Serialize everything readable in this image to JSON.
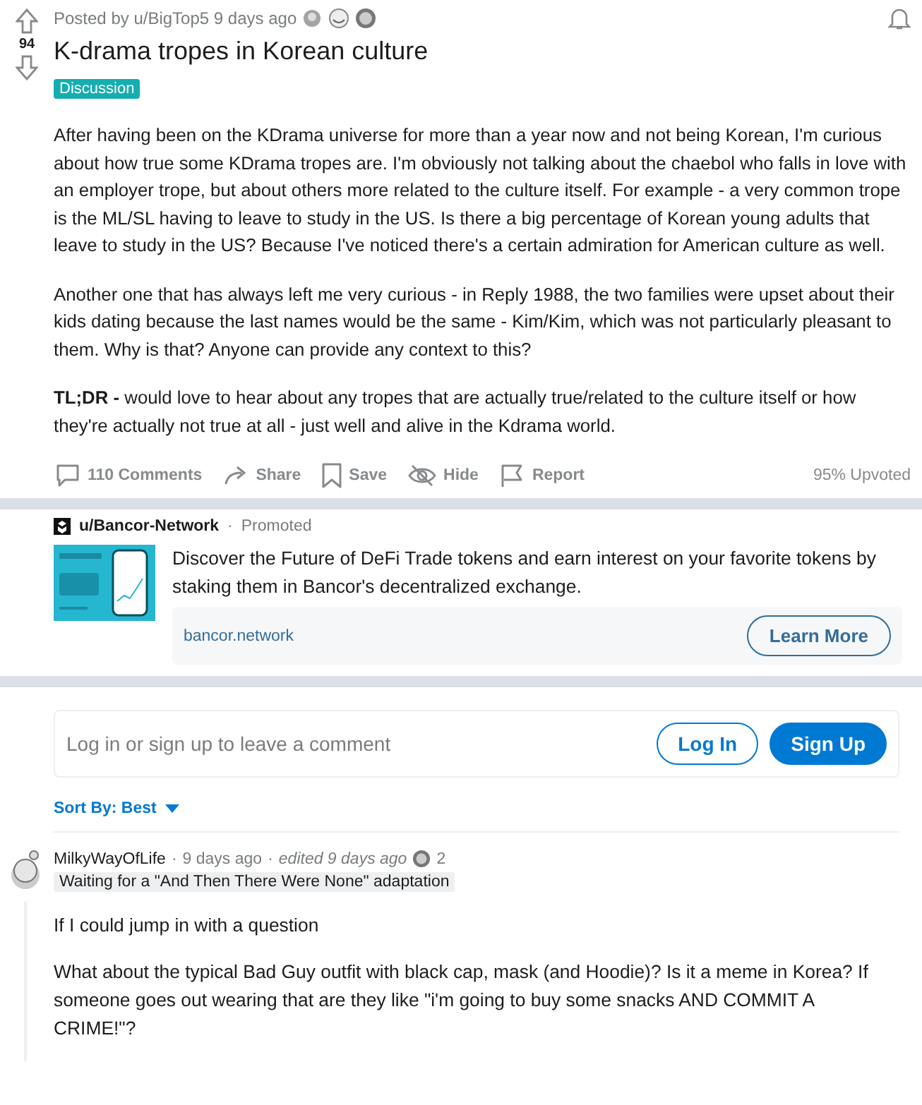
{
  "post": {
    "byline": "Posted by u/BigTop5 9 days ago",
    "votes": "94",
    "title": "K-drama tropes in Korean culture",
    "flair": "Discussion",
    "paragraphs": [
      "After having been on the KDrama universe for more than a year now and not being Korean, I'm curious about how true some KDrama tropes are. I'm obviously not talking about the chaebol who falls in love with an employer trope, but about others more related to the culture itself. For example - a very common trope is the ML/SL having to leave to study in the US. Is there a big percentage of Korean young adults that leave to study in the US? Because I've noticed there's a certain admiration for American culture as well.",
      "Another one that has always left me very curious - in Reply 1988, the two families were upset about their kids dating because the last names would be the same - Kim/Kim, which was not particularly pleasant to them. Why is that? Anyone can provide any context to this?",
      "**TL;DR -** would love to hear about any tropes that are actually true/related to the culture itself or how they're actually not true at all - just well and alive in the Kdrama world."
    ],
    "actions": [
      {
        "kind": "comments",
        "label": "110 Comments"
      },
      {
        "kind": "share",
        "label": "Share"
      },
      {
        "kind": "save",
        "label": "Save"
      },
      {
        "kind": "hide",
        "label": "Hide"
      },
      {
        "kind": "report",
        "label": "Report"
      }
    ],
    "upvoted": "95% Upvoted"
  },
  "ad": {
    "user": "u/Bancor-Network",
    "separator": "·",
    "promoted": "Promoted",
    "text": "Discover the Future of DeFi Trade tokens and earn interest on your favorite tokens by staking them in Bancor's decentralized exchange.",
    "domain": "bancor.network",
    "button": "Learn More"
  },
  "comment_box": {
    "placeholder": "Log in or sign up to leave a comment",
    "buttons": [
      {
        "kind": "outline",
        "label": "Log In"
      },
      {
        "kind": "filled",
        "label": "Sign Up"
      }
    ]
  },
  "sort": {
    "label": "Sort By: Best"
  },
  "comments": [
    {
      "author": "MilkyWayOfLife",
      "separator": "·",
      "time": "9 days ago",
      "edited": "edited 9 days ago",
      "award_count": "2",
      "flair": "Waiting for a \"And Then There Were None\" adaptation",
      "paragraphs": [
        "If I could jump in with a question",
        "What about the typical Bad Guy outfit with black cap, mask (and Hoodie)? Is it a meme in Korea? If someone goes out wearing that are they like \"i'm going to buy some snacks AND COMMIT A CRIME!\"?"
      ]
    }
  ]
}
